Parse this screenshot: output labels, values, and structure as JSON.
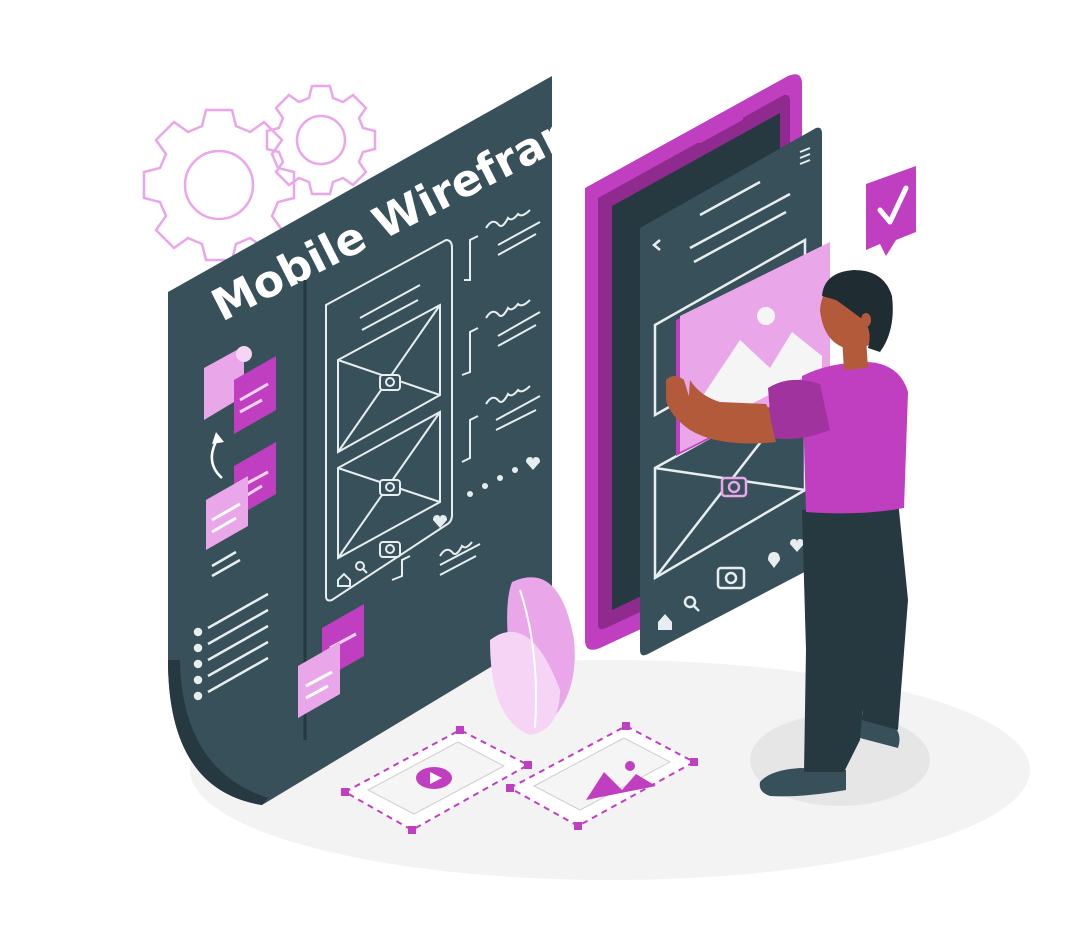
{
  "illustration": {
    "title": "Mobile Wireframe",
    "colors": {
      "board": "#37505a",
      "board_dark": "#263840",
      "accent": "#c03fc0",
      "accent_light": "#e9a6e9",
      "accent_pale": "#f5d4f5",
      "line": "#e7eef0",
      "skin": "#b35a3b",
      "hair": "#1f2d33",
      "ground": "#f2f2f2"
    },
    "icons": [
      "gear-icon",
      "checkmark-speech-icon",
      "camera-icon",
      "home-icon",
      "search-icon",
      "heart-icon",
      "location-pin-icon",
      "play-icon",
      "mountain-image-icon",
      "back-arrow-icon",
      "hamburger-menu-icon"
    ]
  }
}
